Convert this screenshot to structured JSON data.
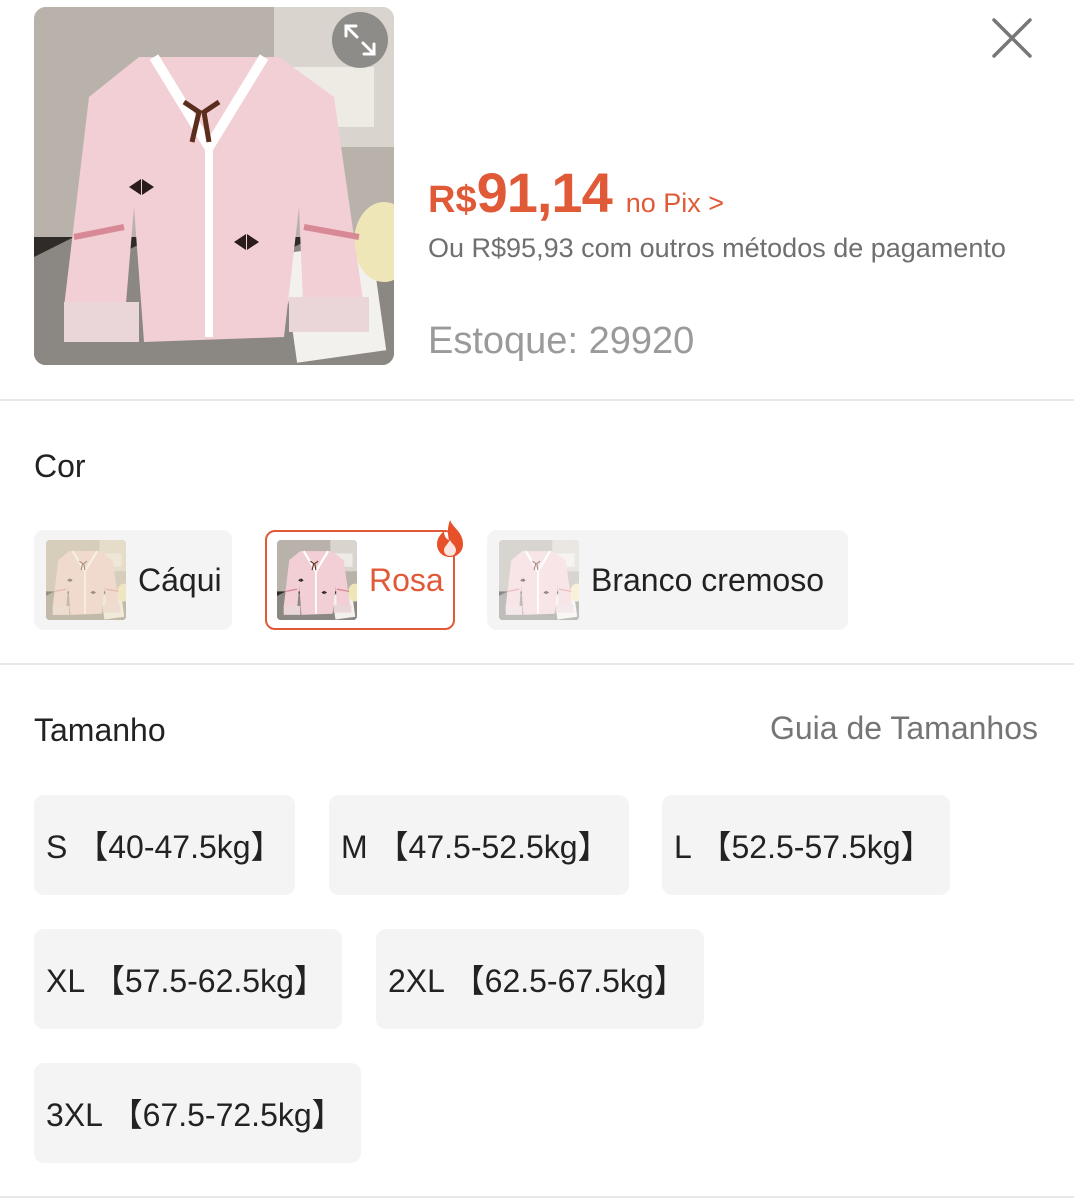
{
  "product": {
    "currency": "R$",
    "price": "91,14",
    "pix_label": "no Pix >",
    "alt_price_text": "Ou R$95,93 com outros métodos de pagamento",
    "stock_label": "Estoque:",
    "stock_value": "29920"
  },
  "color_section": {
    "title": "Cor",
    "options": [
      {
        "label": "Cáqui",
        "selected": false
      },
      {
        "label": "Rosa",
        "selected": true,
        "badge": "fire-icon"
      },
      {
        "label": "Branco cremoso",
        "selected": false
      }
    ]
  },
  "size_section": {
    "title": "Tamanho",
    "guide_label": "Guia de Tamanhos",
    "options": [
      {
        "label": "S 【40-47.5kg】"
      },
      {
        "label": "M 【47.5-52.5kg】"
      },
      {
        "label": "L 【52.5-57.5kg】"
      },
      {
        "label": "XL 【57.5-62.5kg】"
      },
      {
        "label": "2XL 【62.5-67.5kg】"
      },
      {
        "label": "3XL 【67.5-72.5kg】"
      }
    ]
  },
  "icons": {
    "expand": "expand-icon",
    "close": "close-icon",
    "hot": "fire-icon"
  },
  "colors": {
    "accent": "#e05a38",
    "option_bg": "#f4f4f4",
    "muted_text": "#757575"
  }
}
